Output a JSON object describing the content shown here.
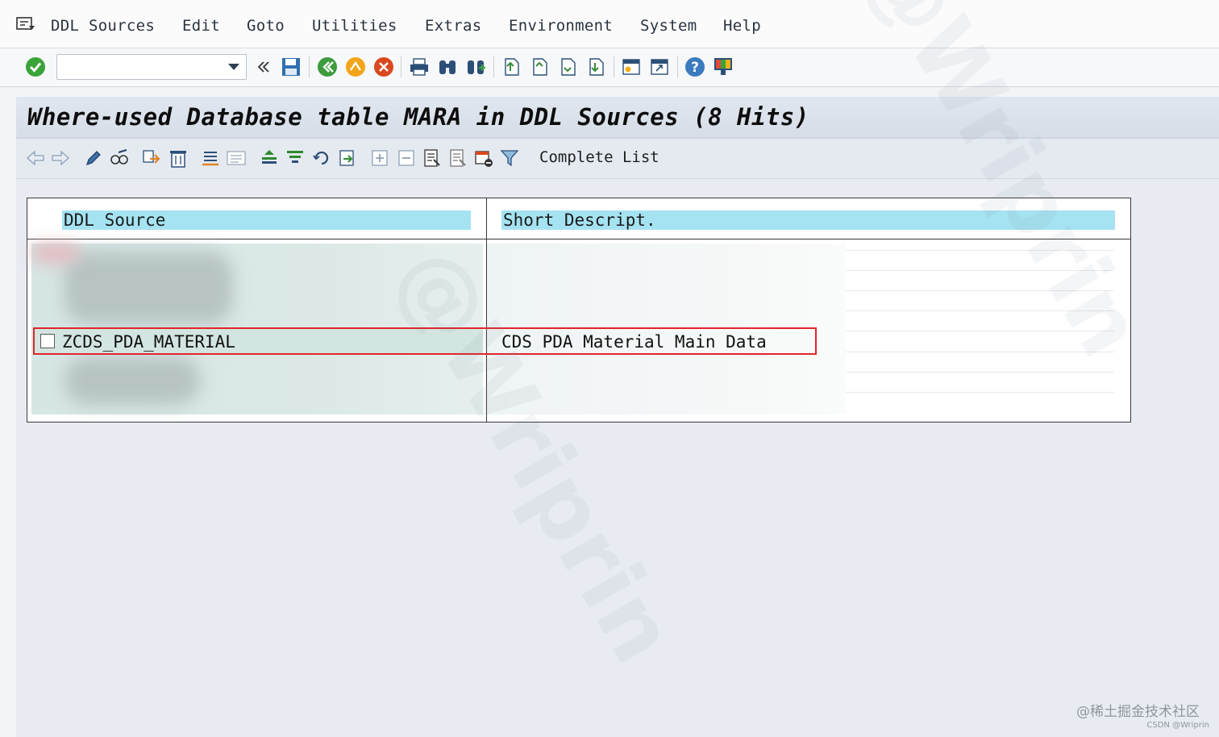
{
  "menu": {
    "items": [
      {
        "label": "DDL Sources"
      },
      {
        "label": "Edit"
      },
      {
        "label": "Goto"
      },
      {
        "label": "Utilities"
      },
      {
        "label": "Extras"
      },
      {
        "label": "Environment"
      },
      {
        "label": "System"
      },
      {
        "label": "Help"
      }
    ]
  },
  "toolbar": {
    "command_value": ""
  },
  "screen": {
    "title": "Where-used Database table MARA in DDL Sources (8 Hits)"
  },
  "app_toolbar": {
    "complete_list_label": "Complete List"
  },
  "grid": {
    "columns": [
      "DDL Source",
      "Short Descript."
    ],
    "rows": [
      {
        "ddl_source": "ZCDS_PDA_MATERIAL",
        "short_descript": "CDS PDA Material Main Data",
        "checked": false
      }
    ]
  },
  "colors": {
    "header_cell": "#a5e3f2",
    "highlight_border": "#e2252b",
    "title_bar": "#d9e0ea"
  },
  "watermark": {
    "text": "@Wriprin",
    "credit_main": "@稀土掘金技术社区",
    "credit_sub": "CSDN @Wriprin"
  }
}
